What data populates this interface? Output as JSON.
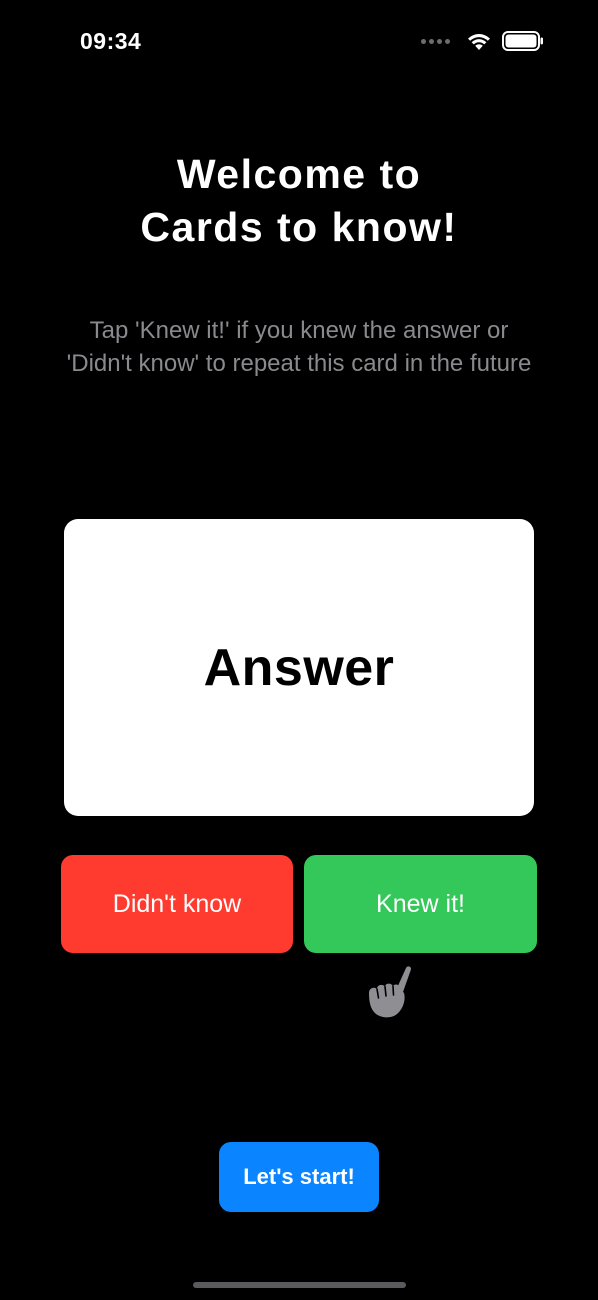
{
  "status_bar": {
    "time": "09:34",
    "icons": [
      "cellular-dots-icon",
      "wifi-icon",
      "battery-icon"
    ]
  },
  "welcome": {
    "title_line1": "Welcome to",
    "title_line2": "Cards to know!",
    "subtitle_line1": "Tap 'Knew it!' if you knew the answer or",
    "subtitle_line2": "'Didn't know' to repeat this card in the future"
  },
  "card": {
    "text": "Answer"
  },
  "actions": {
    "didnt_know_label": "Didn't know",
    "knew_it_label": "Knew it!",
    "hint_icon": "pointing-hand-icon"
  },
  "start": {
    "label": "Let's start!"
  },
  "colors": {
    "background": "#000000",
    "didnt_know": "#ff3b30",
    "knew_it": "#34c759",
    "start": "#0a84ff",
    "subtitle": "#8a8a8e"
  }
}
